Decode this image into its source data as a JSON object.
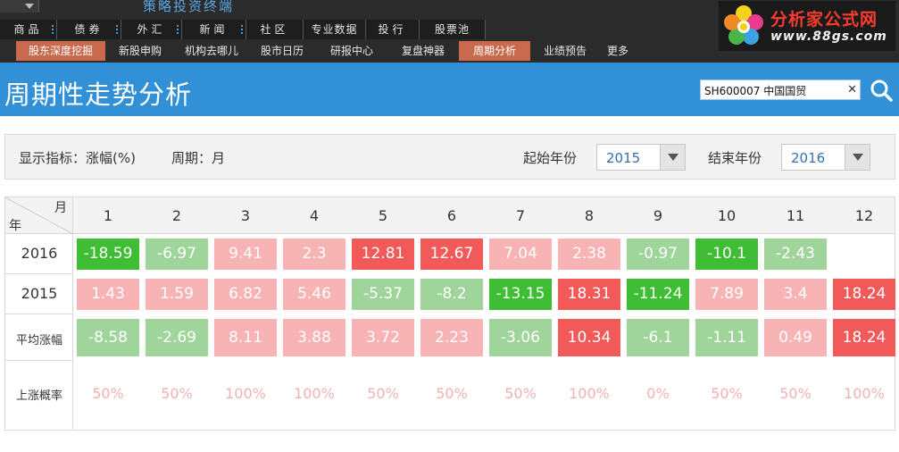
{
  "app": {
    "title": "策略投资终端"
  },
  "menu": [
    {
      "label": "商品",
      "dots": true
    },
    {
      "label": "债券",
      "dots": true
    },
    {
      "label": "外汇",
      "dots": true
    },
    {
      "label": "新闻",
      "dots": true
    },
    {
      "label": "社区",
      "dots": false
    },
    {
      "label": "专业数据",
      "dots": false
    },
    {
      "label": "投行",
      "dots": false
    },
    {
      "label": "股票池",
      "dots": false
    }
  ],
  "tabs": [
    {
      "label": "股东深度挖掘",
      "active": true
    },
    {
      "label": "新股申购",
      "active": false
    },
    {
      "label": "机构去哪儿",
      "active": false
    },
    {
      "label": "股市日历",
      "active": false
    },
    {
      "label": "研报中心",
      "active": false
    },
    {
      "label": "复盘神器",
      "active": false
    },
    {
      "label": "周期分析",
      "active": true
    },
    {
      "label": "业绩预告",
      "active": false
    },
    {
      "label": "更多",
      "active": false
    }
  ],
  "logo": {
    "brand": "分析家公式网",
    "url": "www.88gs.com"
  },
  "header": {
    "title": "周期性走势分析"
  },
  "search": {
    "value": "SH600007 中国国贸"
  },
  "filters": {
    "indicator": "显示指标：涨幅(%)",
    "period": "周期：月",
    "start_label": "起始年份",
    "start_value": "2015",
    "end_label": "结束年份",
    "end_value": "2016"
  },
  "table": {
    "corner_month": "月",
    "corner_year": "年",
    "months": [
      "1",
      "2",
      "3",
      "4",
      "5",
      "6",
      "7",
      "8",
      "9",
      "10",
      "11",
      "12"
    ],
    "rows": [
      {
        "label": "2016",
        "values": [
          "-18.59",
          "-6.97",
          "9.41",
          "2.3",
          "12.81",
          "12.67",
          "7.04",
          "2.38",
          "-0.97",
          "-10.1",
          "-2.43",
          ""
        ]
      },
      {
        "label": "2015",
        "values": [
          "1.43",
          "1.59",
          "6.82",
          "5.46",
          "-5.37",
          "-8.2",
          "-13.15",
          "18.31",
          "-11.24",
          "7.89",
          "3.4",
          "18.24"
        ]
      },
      {
        "label": "平均涨幅",
        "values": [
          "-8.58",
          "-2.69",
          "8.11",
          "3.88",
          "3.72",
          "2.23",
          "-3.06",
          "10.34",
          "-6.1",
          "-1.11",
          "0.49",
          "18.24"
        ]
      }
    ],
    "prob_label": "上涨概率",
    "prob_values": [
      "50%",
      "50%",
      "100%",
      "100%",
      "50%",
      "50%",
      "50%",
      "100%",
      "0%",
      "50%",
      "50%",
      "100%"
    ]
  },
  "colors": {
    "strong_up": "#f25a5a",
    "mild_up": "#f8b4b4",
    "strong_down": "#3fbe35",
    "mild_down": "#9fd49b",
    "header_blue": "#3290d6"
  }
}
